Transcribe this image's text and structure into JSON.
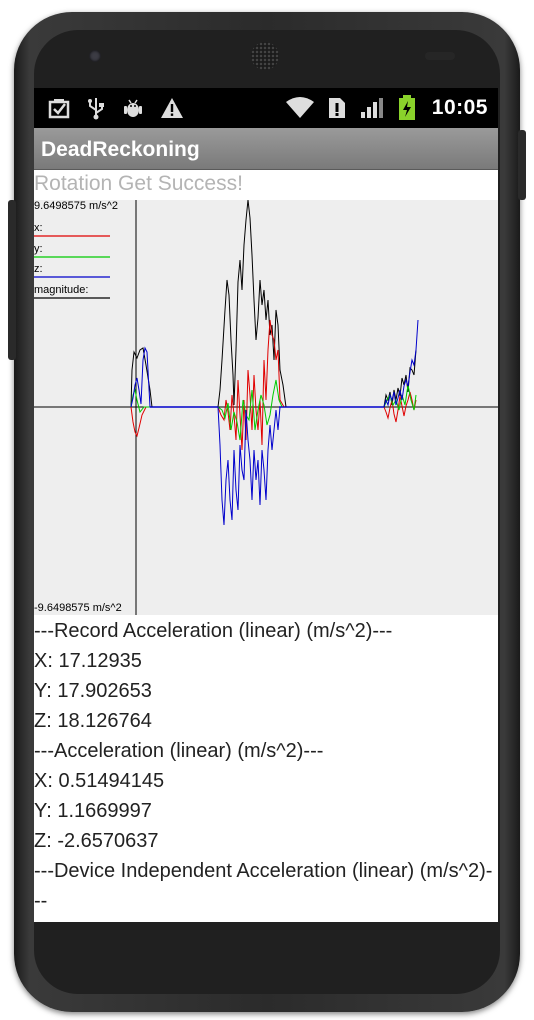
{
  "status_bar": {
    "icons": [
      "bag-check-icon",
      "usb-icon",
      "android-debug-icon",
      "warning-icon",
      "wifi-icon",
      "sim-alert-icon",
      "signal-icon",
      "battery-charging-icon"
    ],
    "time": "10:05"
  },
  "app": {
    "title": "DeadReckoning"
  },
  "rotation_status": "Rotation Get Success!",
  "graph": {
    "max_label": "9.6498575 m/s^2",
    "min_label": "-9.6498575 m/s^2",
    "legend": [
      {
        "label": "x:",
        "color": "#e00000"
      },
      {
        "label": "y:",
        "color": "#00cc00"
      },
      {
        "label": "z:",
        "color": "#0000cc"
      },
      {
        "label": "magnitude:",
        "color": "#000000"
      }
    ]
  },
  "readout": {
    "record_header": "---Record Acceleration (linear) (m/s^2)---",
    "record_x": "X: 17.12935",
    "record_y": "Y: 17.902653",
    "record_z": "Z: 18.126764",
    "accel_header": "---Acceleration (linear) (m/s^2)---",
    "accel_x": "X: 0.51494145",
    "accel_y": "Y: 1.1669997",
    "accel_z": "Z: -2.6570637",
    "device_header": "---Device Independent Acceleration (linear) (m/s^2)---"
  },
  "colors": {
    "x": "#e00000",
    "y": "#00cc00",
    "z": "#0000cc",
    "magnitude": "#000000",
    "titlebar": "#8a8a8a",
    "graph_bg": "#eeeeee"
  }
}
